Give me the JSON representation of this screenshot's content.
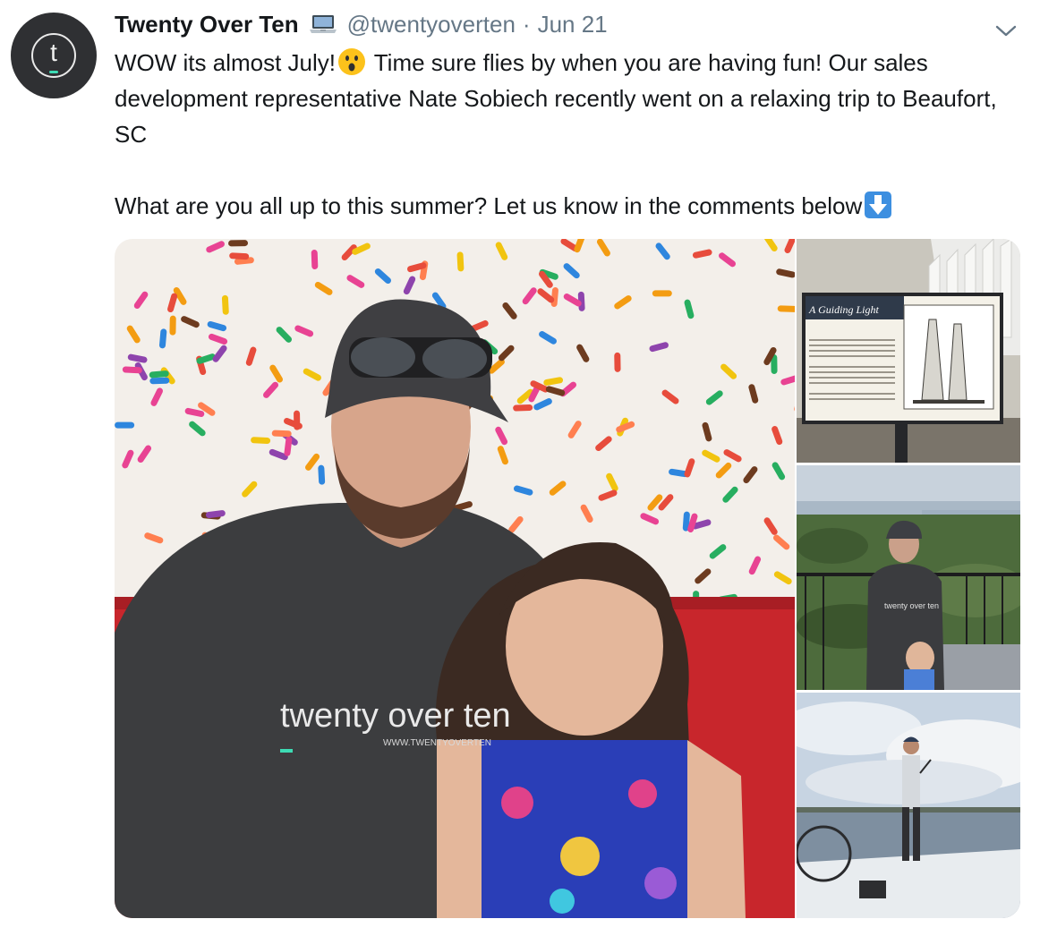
{
  "tweet": {
    "avatar_letter": "t",
    "display_name": "Twenty Over Ten",
    "handle": "@twentyoverten",
    "separator": "·",
    "date": "Jun 21",
    "text_line1_a": "WOW its almost July!",
    "text_line1_b": " Time sure flies by when you are having fun! Our sales development representative Nate Sobiech recently went on a relaxing trip to Beaufort, SC",
    "text_line2": "What are you all up to this summer? Let us know in the comments below",
    "icons": [
      "laptop-icon",
      "astonished-face-emoji",
      "down-arrow-emoji",
      "chevron-down-icon"
    ]
  },
  "media": {
    "main_photo": {
      "shirt_text": "twenty over ten",
      "shirt_url": "WWW.TWENTYOVERTEN"
    },
    "sign_photo": {
      "sign_title": "A Guiding Light"
    },
    "balcony_photo": {
      "shirt_text": "twenty over ten"
    },
    "boat_photo": {}
  },
  "colors": {
    "text": "#14171a",
    "muted": "#657786",
    "avatar_bg": "#2f3033",
    "avatar_accent": "#3ddbb4"
  }
}
